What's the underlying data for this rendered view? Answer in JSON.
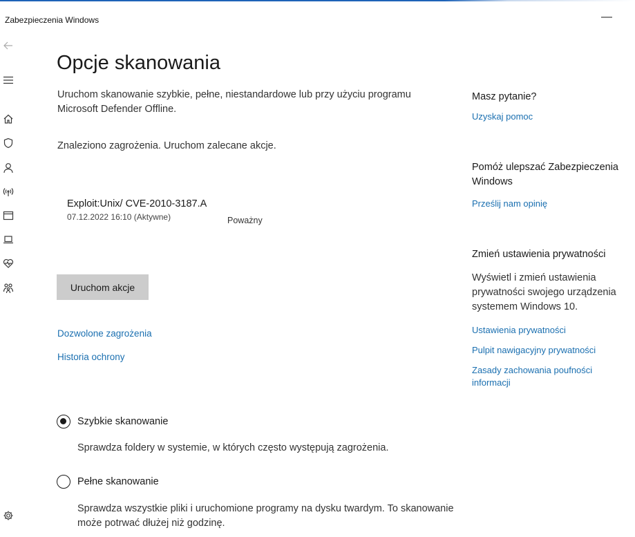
{
  "window": {
    "title": "Zabezpieczenia Windows",
    "minimize_symbol": "—"
  },
  "nav": {
    "icons": [
      "back-arrow-icon",
      "hamburger-menu-icon",
      "home-icon",
      "shield-icon",
      "person-icon",
      "wireless-icon",
      "app-browser-icon",
      "laptop-icon",
      "heart-icon",
      "family-icon",
      "gear-icon"
    ]
  },
  "main": {
    "title": "Opcje skanowania",
    "subtitle": "Uruchom skanowanie szybkie, pełne, niestandardowe lub przy użyciu programu Microsoft Defender Offline.",
    "status": "Znaleziono zagrożenia. Uruchom zalecane akcje.",
    "threat": {
      "name": "Exploit:Unix/ CVE-2010-3187.A",
      "severity": "Poważny",
      "date": "07.12.2022 16:10 (Aktywne)"
    },
    "run_button": "Uruchom akcje",
    "links": {
      "allowed": "Dozwolone zagrożenia",
      "history": "Historia ochrony"
    },
    "scan_options": [
      {
        "label": "Szybkie skanowanie",
        "description": "Sprawdza foldery w systemie, w których często występują zagrożenia.",
        "checked": true
      },
      {
        "label": "Pełne skanowanie",
        "description": "Sprawdza wszystkie pliki i uruchomione programy na dysku twardym. To skanowanie może potrwać dłużej niż godzinę.",
        "checked": false
      }
    ]
  },
  "side": {
    "question_heading": "Masz pytanie?",
    "help_link": "Uzyskaj pomoc",
    "improve_heading": "Pomóż ulepszać Zabezpieczenia Windows",
    "feedback_link": "Prześlij nam opinię",
    "privacy_heading": "Zmień ustawienia prywatności",
    "privacy_text": "Wyświetl i zmień ustawienia prywatności swojego urządzenia systemem Windows 10.",
    "privacy_links": [
      "Ustawienia prywatności",
      "Pulpit nawigacyjny prywatności",
      "Zasady zachowania poufności informacji"
    ]
  },
  "colors": {
    "accent": "#1e63b8",
    "link": "#1a6fb0",
    "button": "#cccccc"
  }
}
